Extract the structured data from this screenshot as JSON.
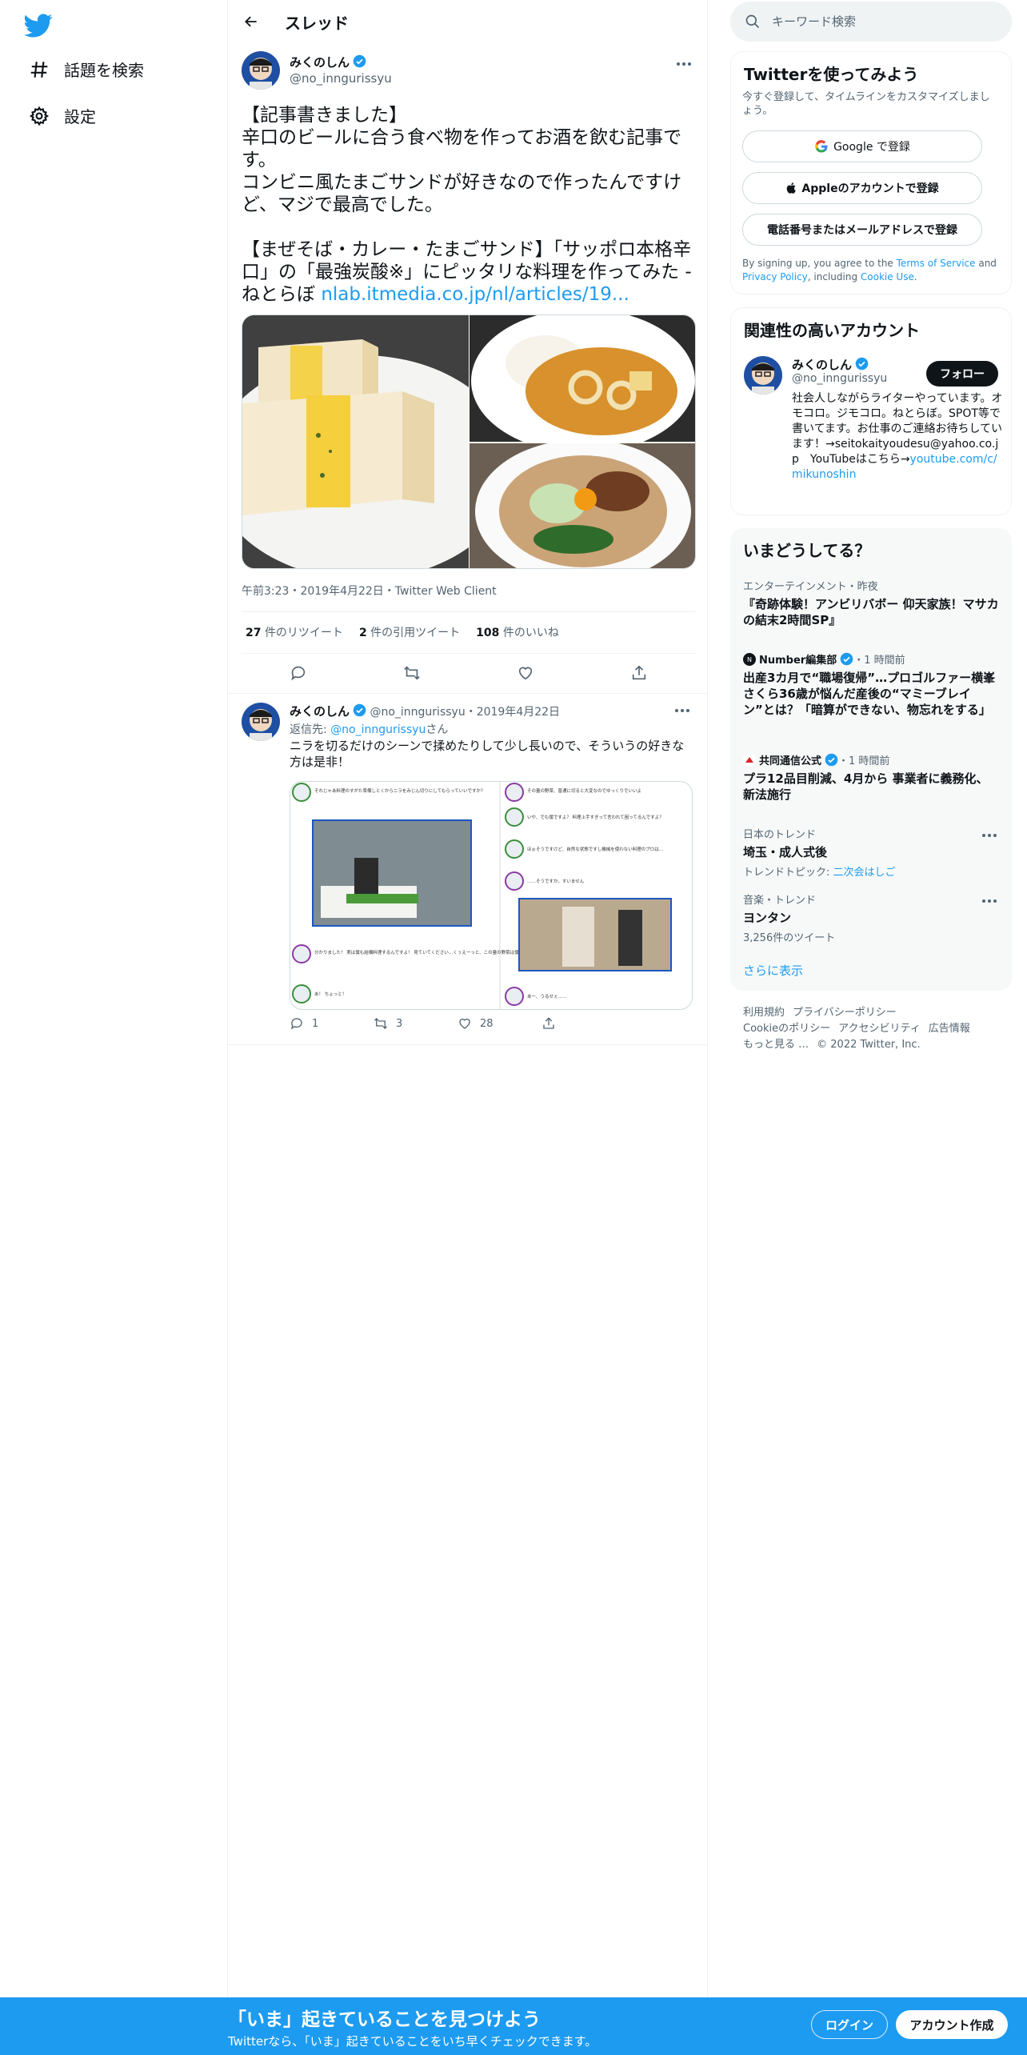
{
  "nav": {
    "explore_label": "話題を検索",
    "settings_label": "設定"
  },
  "header": {
    "title": "スレッド"
  },
  "main_tweet": {
    "display_name": "みくのしん",
    "handle": "@no_inngurissyu",
    "text_lines": [
      "【記事書きました】",
      "辛口のビールに合う食べ物を作ってお酒を飲む記事です。",
      "コンビニ風たまごサンドが好きなので作ったんですけど、マジで最高でした。",
      "",
      "【まぜそば・カレー・たまごサンド】「サッポロ本格辛口」の「最強炭酸※」にピッタリな料理を作ってみた - ねとらぼ"
    ],
    "link_text": "nlab.itmedia.co.jp/nl/articles/19...",
    "meta": "午前3:23・2019年4月22日・Twitter Web Client",
    "retweets_count": "27",
    "retweets_label": "件のリツイート",
    "quotes_count": "2",
    "quotes_label": "件の引用ツイート",
    "likes_count": "108",
    "likes_label": "件のいいね"
  },
  "reply_tweet": {
    "display_name": "みくのしん",
    "handle": "@no_inngurissyu",
    "date": "・2019年4月22日",
    "reply_prefix": "返信先: ",
    "reply_to": "@no_inngurissyu",
    "reply_suffix": "さん",
    "text": "ニラを切るだけのシーンで揉めたりして少し長いので、そういうの好きな方は是非！",
    "reply_count": "1",
    "retweet_count": "3",
    "like_count": "28",
    "comic_lines": {
      "l1": "それじゃあ料理のすがた準備しとくからニラをみじん切りにしてもらっていいですか？",
      "l2": "分かりました！ 実は僕も結構料理するんですよ！ 見ていてください…くぅえーっと、この量の野菜は僕ちょっと…",
      "l3": "あ！ ちょっと！",
      "r1": "その量の野菜、普通に切ると大変なのでゆっくりでいいよ",
      "r2": "いや、でも僕ですよ？ 料理上手すぎって言われて困ってるんですよ？",
      "r3": "ほぉそうですけど、自然な状態ですし機械を使わない料理のプロは…",
      "r4": "……そうですか。すいません",
      "r5": "あー、うるせぇ……"
    }
  },
  "search": {
    "placeholder": "キーワード検索"
  },
  "signup_card": {
    "title": "Twitterを使ってみよう",
    "desc": "今すぐ登録して、タイムラインをカスタマイズしましょう。",
    "google_label": "Google で登録",
    "apple_label": "Appleのアカウントで登録",
    "phone_label": "電話番号またはメールアドレスで登録",
    "terms_prefix": "By signing up, you agree to the ",
    "terms_link": "Terms of Service",
    "terms_and": " and ",
    "privacy_link": "Privacy Policy",
    "terms_including": ", including ",
    "cookie_link": "Cookie Use",
    "terms_end": "."
  },
  "related_card": {
    "title": "関連性の高いアカウント",
    "display_name": "みくのしん",
    "handle": "@no_inngurissyu",
    "follow_label": "フォロー",
    "bio": "社会人しながらライターやっています。オモコロ。ジモコロ。ねとらぼ。SPOT等で書いてます。お仕事のご連絡お待ちしています！→seitokaityoudesu@yahoo.co.jp　YouTubeはこちら→",
    "bio_link": "youtube.com/c/mikunoshin"
  },
  "trends_card": {
    "title": "いまどうしてる？",
    "items": [
      {
        "category": "エンターテインメント・昨夜",
        "title": "『奇跡体験！アンビリバボー 仰天家族！マサカの結末2時間SP』"
      },
      {
        "source": "Number編集部",
        "time": "・1 時間前",
        "title": "出産3カ月で“職場復帰”…プロゴルファー横峯さくら36歳が悩んだ産後の“マミーブレイン”とは？「暗算ができない、物忘れをする」"
      },
      {
        "source": "共同通信公式",
        "time": "・1 時間前",
        "title": "プラ12品目削減、4月から 事業者に義務化、新法施行"
      },
      {
        "category": "日本のトレンド",
        "title": "埼玉・成人式後",
        "sub_prefix": "トレンドトピック: ",
        "sub_link": "二次会はしご"
      },
      {
        "category": "音楽・トレンド",
        "title": "ヨンタン",
        "sub": "3,256件のツイート"
      }
    ],
    "show_more": "さらに表示"
  },
  "footer": {
    "links": [
      "利用規約",
      "プライバシーポリシー",
      "Cookieのポリシー",
      "アクセシビリティ",
      "広告情報",
      "もっと見る …"
    ],
    "copyright": "© 2022 Twitter, Inc."
  },
  "bottom_bar": {
    "title": "「いま」起きていることを見つけよう",
    "subtitle": "Twitterなら、「いま」起きていることをいち早くチェックできます。",
    "login_label": "ログイン",
    "signup_label": "アカウント作成"
  },
  "colors": {
    "brand": "#1d9bf0",
    "text": "#0f1419",
    "muted": "#536471"
  }
}
